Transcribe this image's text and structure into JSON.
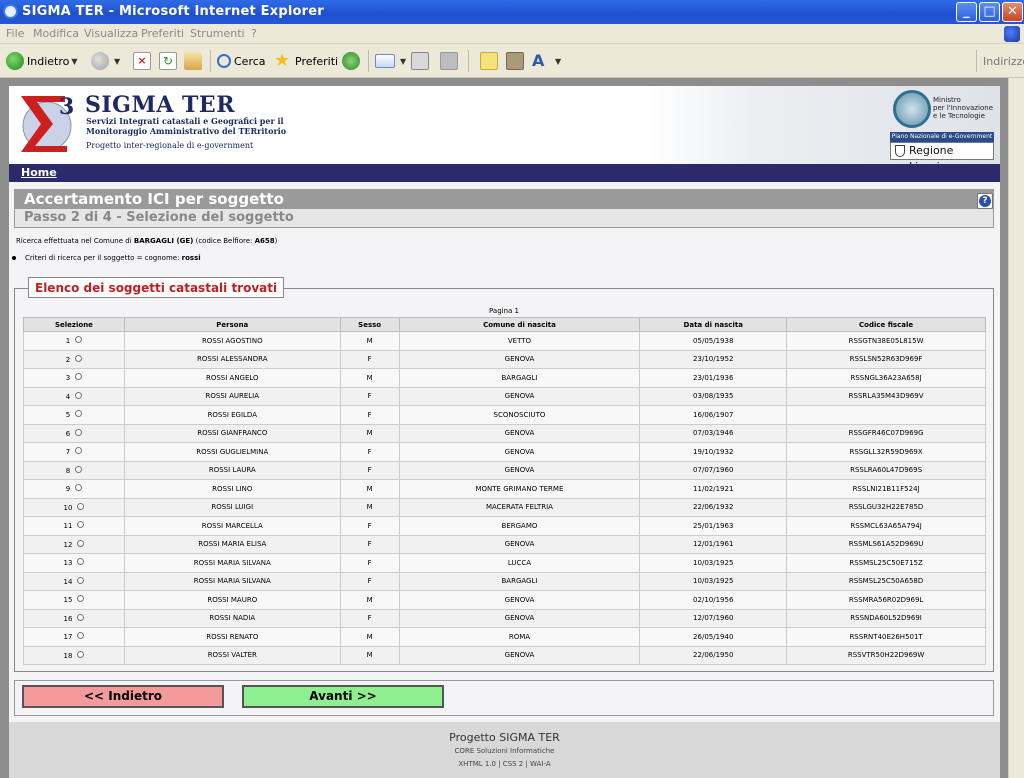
{
  "window": {
    "title": "SIGMA TER - Microsoft Internet Explorer",
    "min": "_",
    "max": "□",
    "close": "✕"
  },
  "menu": [
    "File",
    "Modifica",
    "Visualizza",
    "Preferiti",
    "Strumenti",
    "?"
  ],
  "toolbar": {
    "back": "Indietro",
    "search": "Cerca",
    "favorites": "Preferiti",
    "address": "Indirizzo"
  },
  "header": {
    "brand": "SIGMA TER",
    "sub1": "Servizi Integrati catastali e Geografici per il",
    "sub2": "Monitoraggio Amministrativo del TERritorio",
    "sub3": "Progetto inter-regionale di e-government",
    "ministro1": "Ministro",
    "ministro2": "per l'Innovazione",
    "ministro3": "e le Tecnologie",
    "piano": "Piano Nazionale di e-Government",
    "regione": "Regione Liguria"
  },
  "nav": {
    "home": "Home"
  },
  "heading": {
    "title": "Accertamento ICI per soggetto",
    "step": "Passo 2 di 4 - Selezione del soggetto"
  },
  "info": {
    "ricerca_prefix": "Ricerca effettuata nel Comune di ",
    "comune": "BARGAGLI (GE)",
    "belfiore_prefix": " (codice Belfiore: ",
    "belfiore": "A658",
    "belfiore_suffix": ")",
    "criteri_prefix": "Criteri di ricerca per il soggetto = cognome: ",
    "criteri_value": "rossi"
  },
  "results": {
    "legend": "Elenco dei soggetti catastali trovati",
    "pagina": "Pagina 1",
    "columns": [
      "Selezione",
      "Persona",
      "Sesso",
      "Comune di nascita",
      "Data di nascita",
      "Codice fiscale"
    ],
    "rows": [
      {
        "n": "1",
        "persona": "ROSSI AGOSTINO",
        "sesso": "M",
        "comune": "VETTO",
        "data": "05/05/1938",
        "cf": "RSSGTN38E05L815W"
      },
      {
        "n": "2",
        "persona": "ROSSI ALESSANDRA",
        "sesso": "F",
        "comune": "GENOVA",
        "data": "23/10/1952",
        "cf": "RSSLSN52R63D969F"
      },
      {
        "n": "3",
        "persona": "ROSSI ANGELO",
        "sesso": "M",
        "comune": "BARGAGLI",
        "data": "23/01/1936",
        "cf": "RSSNGL36A23A658J"
      },
      {
        "n": "4",
        "persona": "ROSSI AURELIA",
        "sesso": "F",
        "comune": "GENOVA",
        "data": "03/08/1935",
        "cf": "RSSRLA35M43D969V"
      },
      {
        "n": "5",
        "persona": "ROSSI EGILDA",
        "sesso": "F",
        "comune": "SCONOSCIUTO",
        "data": "16/06/1907",
        "cf": ""
      },
      {
        "n": "6",
        "persona": "ROSSI GIANFRANCO",
        "sesso": "M",
        "comune": "GENOVA",
        "data": "07/03/1946",
        "cf": "RSSGFR46C07D969G"
      },
      {
        "n": "7",
        "persona": "ROSSI GUGLIELMINA",
        "sesso": "F",
        "comune": "GENOVA",
        "data": "19/10/1932",
        "cf": "RSSGLL32R59D969X"
      },
      {
        "n": "8",
        "persona": "ROSSI LAURA",
        "sesso": "F",
        "comune": "GENOVA",
        "data": "07/07/1960",
        "cf": "RSSLRA60L47D969S"
      },
      {
        "n": "9",
        "persona": "ROSSI LINO",
        "sesso": "M",
        "comune": "MONTE GRIMANO TERME",
        "data": "11/02/1921",
        "cf": "RSSLNI21B11F524J"
      },
      {
        "n": "10",
        "persona": "ROSSI LUIGI",
        "sesso": "M",
        "comune": "MACERATA FELTRIA",
        "data": "22/06/1932",
        "cf": "RSSLGU32H22E785D"
      },
      {
        "n": "11",
        "persona": "ROSSI MARCELLA",
        "sesso": "F",
        "comune": "BERGAMO",
        "data": "25/01/1963",
        "cf": "RSSMCL63A65A794J"
      },
      {
        "n": "12",
        "persona": "ROSSI MARIA ELISA",
        "sesso": "F",
        "comune": "GENOVA",
        "data": "12/01/1961",
        "cf": "RSSMLS61A52D969U"
      },
      {
        "n": "13",
        "persona": "ROSSI MARIA SILVANA",
        "sesso": "F",
        "comune": "LUCCA",
        "data": "10/03/1925",
        "cf": "RSSMSL25C50E715Z"
      },
      {
        "n": "14",
        "persona": "ROSSI MARIA SILVANA",
        "sesso": "F",
        "comune": "BARGAGLI",
        "data": "10/03/1925",
        "cf": "RSSMSL25C50A658D"
      },
      {
        "n": "15",
        "persona": "ROSSI MAURO",
        "sesso": "M",
        "comune": "GENOVA",
        "data": "02/10/1956",
        "cf": "RSSMRA56R02D969L"
      },
      {
        "n": "16",
        "persona": "ROSSI NADIA",
        "sesso": "F",
        "comune": "GENOVA",
        "data": "12/07/1960",
        "cf": "RSSNDA60L52D969I"
      },
      {
        "n": "17",
        "persona": "ROSSI RENATO",
        "sesso": "M",
        "comune": "ROMA",
        "data": "26/05/1940",
        "cf": "RSSRNT40E26H501T"
      },
      {
        "n": "18",
        "persona": "ROSSI VALTER",
        "sesso": "M",
        "comune": "GENOVA",
        "data": "22/06/1950",
        "cf": "RSSVTR50H22D969W"
      }
    ]
  },
  "buttons": {
    "back": "<< Indietro",
    "next": "Avanti >>"
  },
  "footer": {
    "project": "Progetto SIGMA TER",
    "company": "CORE Soluzioni Informatiche",
    "standards": "XHTML 1.0 | CSS 2 | WAI-A"
  }
}
